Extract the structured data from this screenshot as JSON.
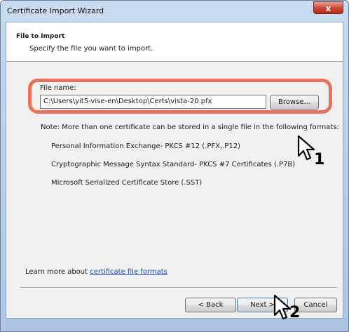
{
  "window": {
    "title": "Certificate Import Wizard",
    "close_glyph": "x"
  },
  "header": {
    "title": "File to Import",
    "subtitle": "Specify the file you want to import."
  },
  "file": {
    "label": "File name:",
    "value": "C:\\Users\\yit5-vise-en\\Desktop\\Certs\\vista-20.pfx",
    "browse_label": "Browse..."
  },
  "note": {
    "text": "Note:  More than one certificate can be stored in a single file in the following formats:",
    "formats": [
      "Personal Information Exchange- PKCS #12 (.PFX,.P12)",
      "Cryptographic Message Syntax Standard- PKCS #7 Certificates (.P7B)",
      "Microsoft Serialized Certificate Store (.SST)"
    ]
  },
  "learn": {
    "prefix": "Learn more about ",
    "link": "certificate file formats"
  },
  "buttons": {
    "back": "< Back",
    "next": "Next >",
    "cancel": "Cancel"
  },
  "annotations": {
    "step1": "1",
    "step2": "2",
    "highlight_color": "#e8735a"
  }
}
